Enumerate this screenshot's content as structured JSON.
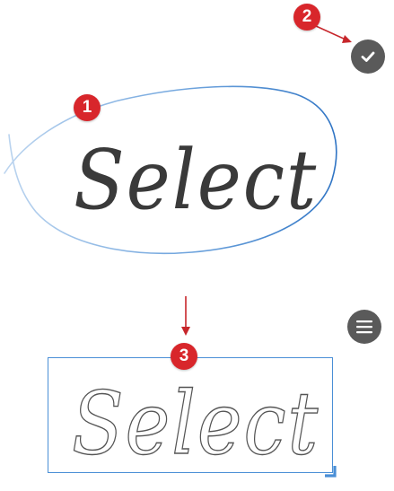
{
  "colors": {
    "badge": "#d8262b",
    "arrow": "#c7262b",
    "lasso": "#3f86d2",
    "ink": "#3a3a3a",
    "selection": "#4a8fd6",
    "button": "#5a5a5a"
  },
  "stage1": {
    "handwriting_text": "Select",
    "badge_label": "1"
  },
  "stage2": {
    "badge_label": "2",
    "confirm_icon": "checkmark-icon"
  },
  "stage3": {
    "badge_label": "3",
    "outline_text": "Select",
    "menu_icon": "hamburger-menu-icon",
    "handle_icon": "resize-corner-icon"
  }
}
